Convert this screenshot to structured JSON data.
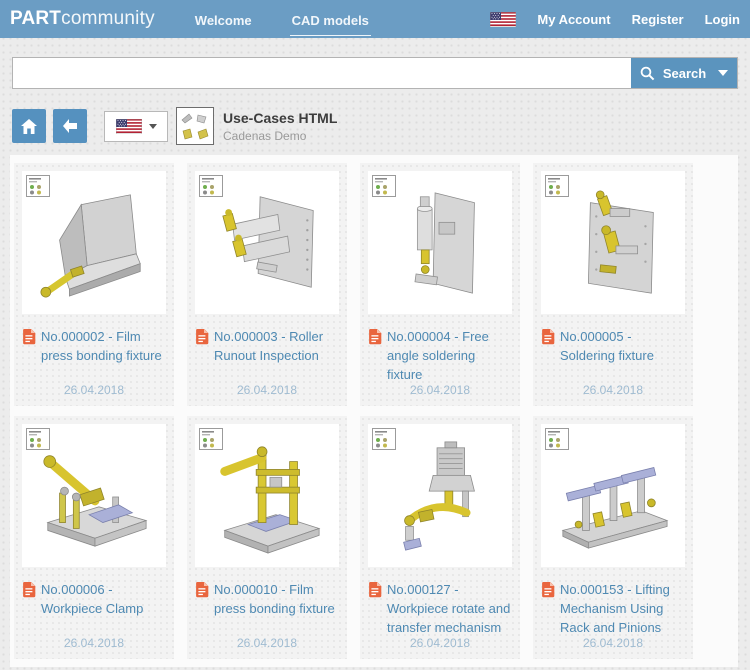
{
  "header": {
    "logo_bold": "PART",
    "logo_light": "community",
    "nav": [
      {
        "label": "Welcome"
      },
      {
        "label": "CAD models"
      }
    ],
    "account": {
      "flag_icon": "us-flag-icon",
      "my_account": "My Account",
      "register": "Register",
      "login": "Login"
    }
  },
  "search": {
    "value": "",
    "placeholder": "",
    "button_label": "Search"
  },
  "toolbar": {
    "home_icon": "home-icon",
    "back_icon": "arrow-left-icon",
    "language_flag": "us-flag-icon",
    "catalog_title": "Use-Cases HTML",
    "catalog_subtitle": "Cadenas Demo"
  },
  "colors": {
    "header_bg": "#6b9dc4",
    "button_blue": "#5591bf",
    "link_blue": "#4e89b2",
    "date_blue": "#9fbbd1",
    "doc_icon_orange": "#e9653e",
    "page_bg": "#ececec",
    "card_bg": "#f3f3f3"
  },
  "cards": [
    {
      "title": "No.000002 - Film press bonding fixture",
      "date": "26.04.2018"
    },
    {
      "title": "No.000003 - Roller Runout Inspection",
      "date": "26.04.2018"
    },
    {
      "title": "No.000004 - Free angle soldering fixture",
      "date": "26.04.2018"
    },
    {
      "title": "No.000005 - Soldering fixture",
      "date": "26.04.2018"
    },
    {
      "title": "No.000006 - Workpiece Clamp",
      "date": "26.04.2018"
    },
    {
      "title": "No.000010 - Film press bonding fixture",
      "date": "26.04.2018"
    },
    {
      "title": "No.000127 - Workpiece rotate and transfer mechanism",
      "date": "26.04.2018"
    },
    {
      "title": "No.000153 - Lifting Mechanism Using Rack and Pinions",
      "date": "26.04.2018"
    }
  ]
}
